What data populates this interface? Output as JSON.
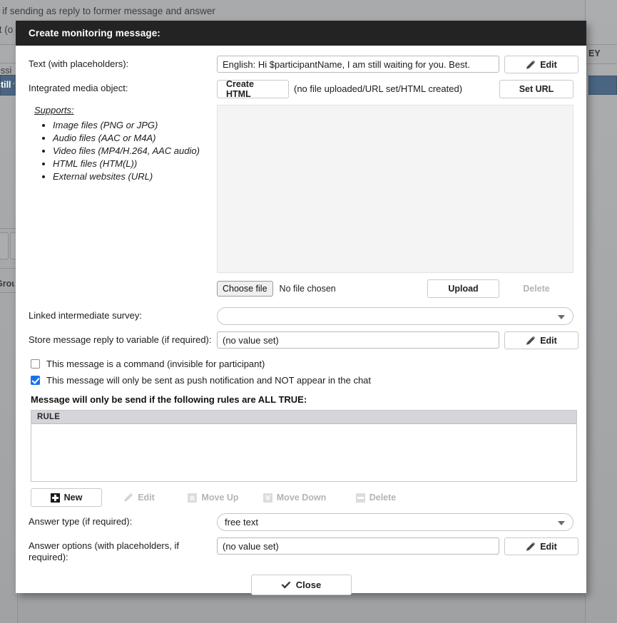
{
  "background": {
    "top_text_line1": "n if sending as reply to former message and answer",
    "top_text_line2": "ct (o",
    "left_row_1": "essi",
    "left_row_2": "still v",
    "left_row_3": "Grou",
    "right_header": "EY"
  },
  "dialog": {
    "title": "Create monitoring message:",
    "text_row": {
      "label": "Text (with placeholders):",
      "value": "English: Hi $participantName, I am still waiting for you. Best.",
      "edit_label": "Edit"
    },
    "media_row": {
      "label": "Integrated media object:",
      "create_html_label": "Create HTML",
      "status_text": "(no file uploaded/URL set/HTML created)",
      "set_url_label": "Set URL"
    },
    "supports": {
      "title": "Supports:",
      "items": [
        "Image files (PNG or JPG)",
        "Audio files (AAC or M4A)",
        "Video files (MP4/H.264, AAC audio)",
        "HTML files (HTM(L))",
        "External websites (URL)"
      ]
    },
    "file_row": {
      "choose_file_label": "Choose file",
      "file_name": "No file chosen",
      "upload_label": "Upload",
      "delete_label": "Delete"
    },
    "survey_row": {
      "label": "Linked intermediate survey:",
      "value": ""
    },
    "variable_row": {
      "label": "Store message reply to variable (if required):",
      "value": "(no value set)",
      "edit_label": "Edit"
    },
    "checkbox_command": {
      "label": "This message is a command (invisible for participant)",
      "checked": false
    },
    "checkbox_push": {
      "label": "This message will only be sent as push notification and NOT appear in the chat",
      "checked": true
    },
    "rules": {
      "heading": "Message will only be send if the following rules are ALL TRUE:",
      "column_header": "RULE",
      "rows": [],
      "toolbar": {
        "new_label": "New",
        "edit_label": "Edit",
        "move_up_label": "Move Up",
        "move_down_label": "Move Down",
        "delete_label": "Delete"
      }
    },
    "answer_type_row": {
      "label": "Answer type (if required):",
      "value": "free text"
    },
    "answer_options_row": {
      "label": "Answer options (with placeholders, if required):",
      "value": "(no value set)",
      "edit_label": "Edit"
    },
    "close_label": "Close"
  },
  "colors": {
    "header_bg": "#232323",
    "checkbox_accent": "#1a73e8",
    "table_header_bg": "#d3d5d8",
    "preview_bg": "#f4f4f4",
    "selection_blue": "#4a6581"
  }
}
